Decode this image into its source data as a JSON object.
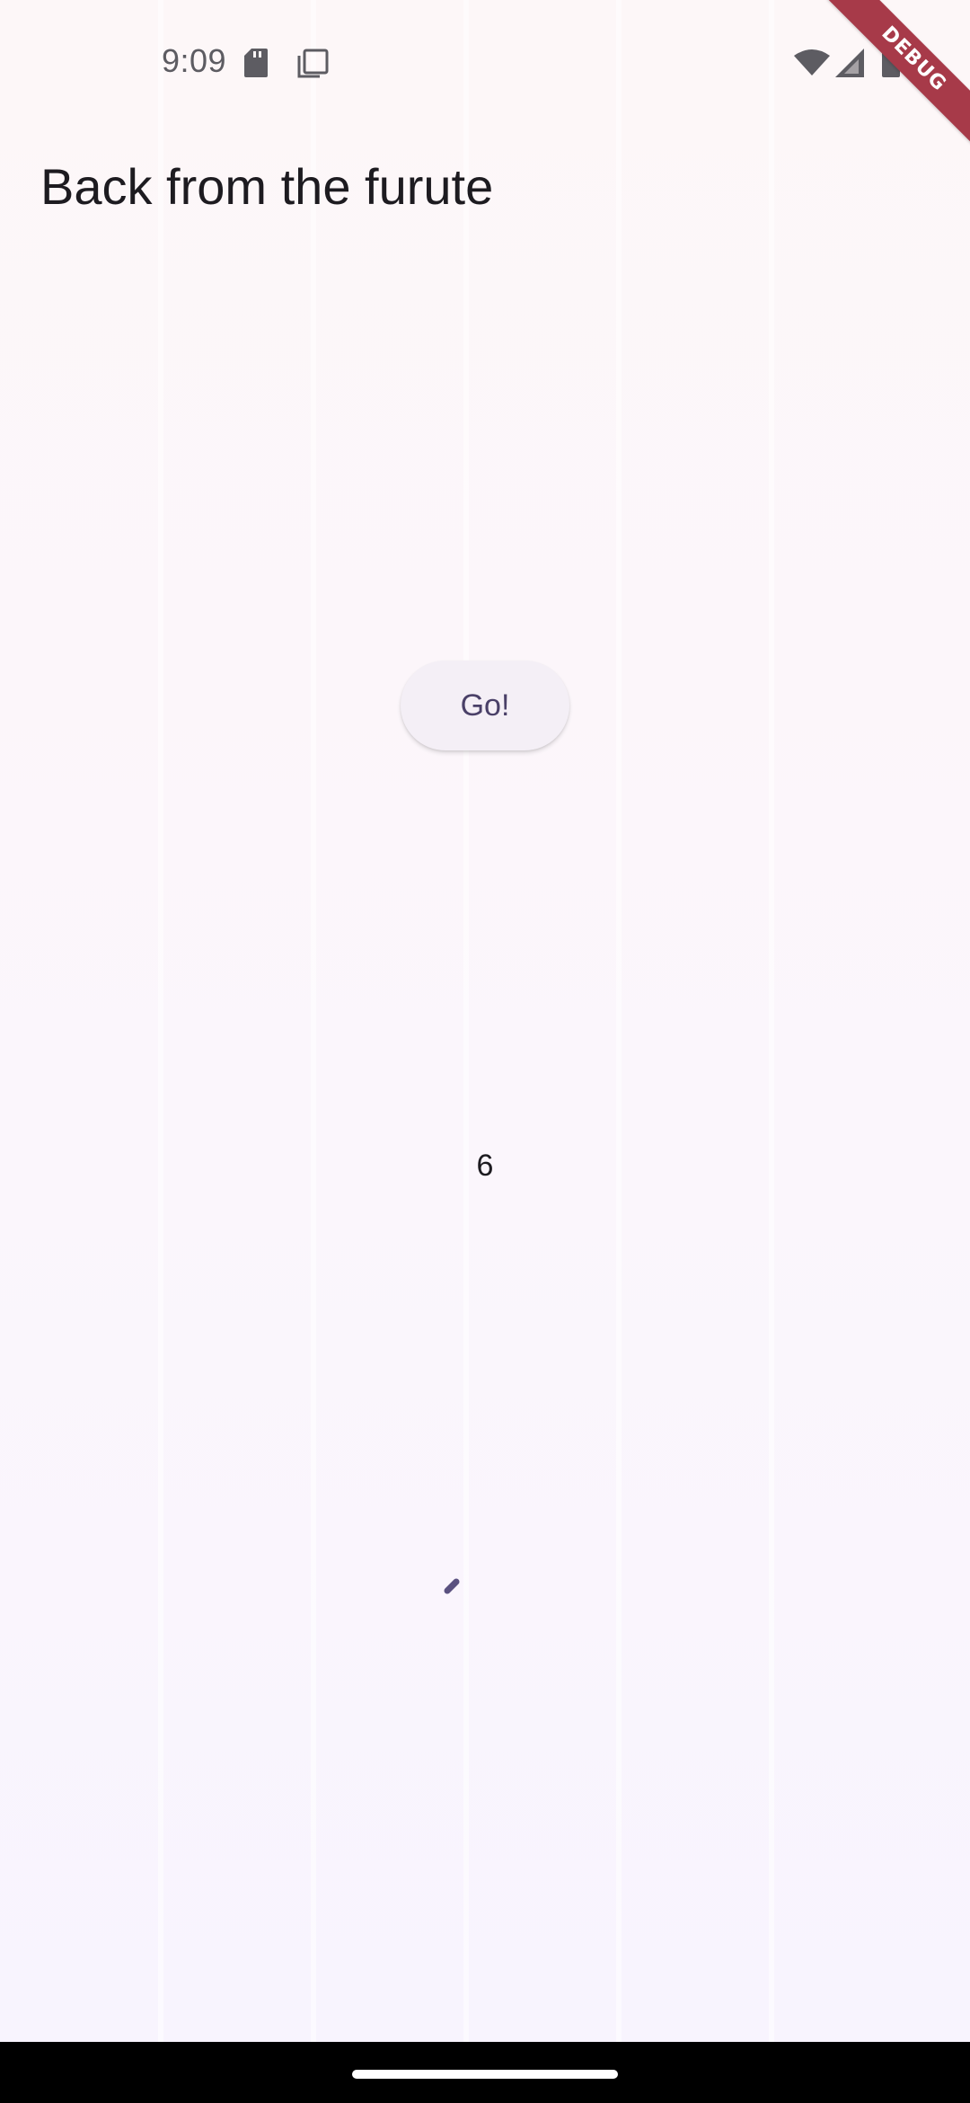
{
  "status_bar": {
    "time": "9:09",
    "icons": [
      "sd-card-icon",
      "screenshot-icon",
      "wifi-icon",
      "cell-signal-icon",
      "battery-icon"
    ]
  },
  "debug_banner": {
    "label": "DEBUG",
    "color": "#a73a49"
  },
  "app_bar": {
    "title": "Back from the furute"
  },
  "main": {
    "go_button_label": "Go!",
    "result_value": "6",
    "progress_icon": "circular-progress-icon"
  },
  "navigation_bar": {
    "home_handle": "home-gesture-handle"
  },
  "colors": {
    "background": "#fbf6fc",
    "button_text": "#4a4068",
    "button_bg": "#f4eff6",
    "title_text": "#1d1b20"
  }
}
